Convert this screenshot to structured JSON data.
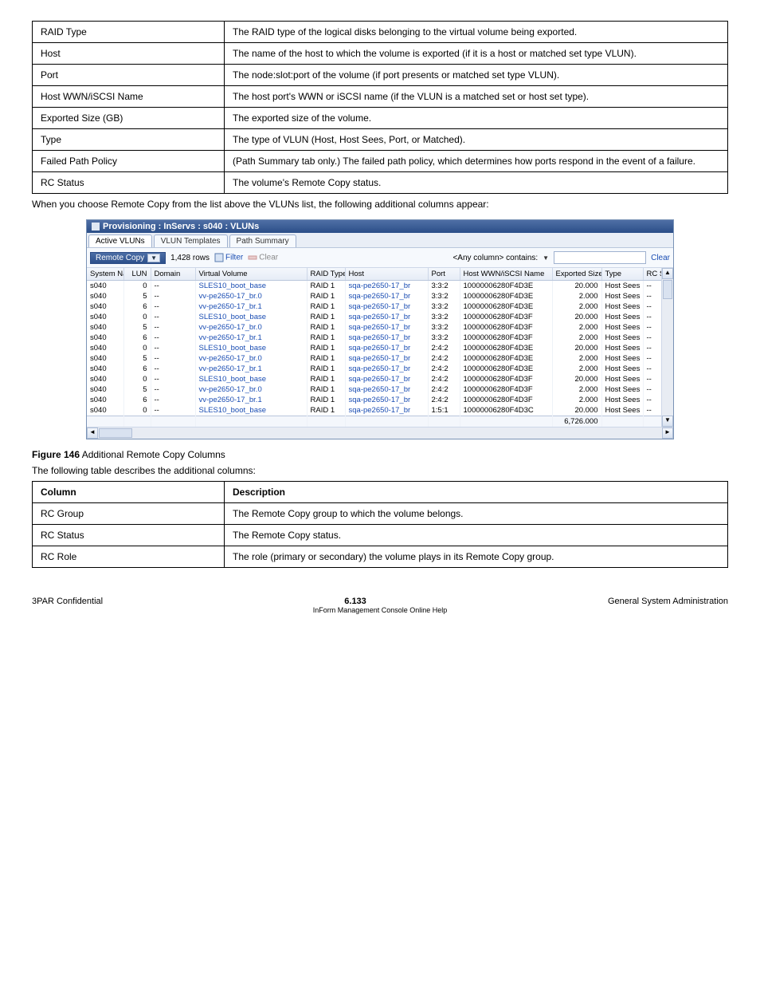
{
  "desc_top": [
    {
      "k": "RAID Type",
      "v": "The RAID type of the logical disks belonging to the virtual volume being exported."
    },
    {
      "k": "Host",
      "v": "The name of the host to which the volume is exported (if it is a host or matched set type VLUN)."
    },
    {
      "k": "Port",
      "v": "The node:slot:port of the volume (if port presents or matched set type VLUN)."
    },
    {
      "k": "Host WWN/iSCSI Name",
      "v": "The host port's WWN or iSCSI name (if the VLUN is a matched set or host set type)."
    },
    {
      "k": "Exported Size (GB)",
      "v": "The exported size of the volume."
    },
    {
      "k": "Type",
      "v": "The type of VLUN (Host, Host Sees, Port, or Matched)."
    },
    {
      "k": "Failed Path Policy",
      "v": "(Path Summary tab only.) The failed path policy, which determines how ports respond in the event of a failure."
    },
    {
      "k": "RC Status",
      "v": "The volume's Remote Copy status."
    }
  ],
  "intro_remote": "When you choose Remote Copy from the list above the VLUNs list, the following additional columns appear:",
  "figure_caption": {
    "num": "Figure 146",
    "text": " Additional Remote Copy Columns"
  },
  "desc_rc_intro": "The following table describes the additional columns:",
  "desc_rc": [
    {
      "k": "Column",
      "v": "Description"
    },
    {
      "k": "RC Group",
      "v": "The Remote Copy group to which the volume belongs."
    },
    {
      "k": "RC Status",
      "v": "The Remote Copy status."
    },
    {
      "k": "RC Role",
      "v": "The role (primary or secondary) the volume plays in its Remote Copy group."
    }
  ],
  "footer": {
    "left": "3PAR Confidential",
    "right": "General System Administration",
    "page": "6.133",
    "sub": "InForm Management Console Online Help "
  },
  "shot": {
    "title": "Provisioning : InServs : s040 : VLUNs",
    "tabs": [
      "Active VLUNs",
      "VLUN Templates",
      "Path Summary"
    ],
    "active_tab": 0,
    "combo_label": "Remote Copy",
    "rows_label": "1,428 rows",
    "filter_label": "Filter",
    "clear_label_tb": "Clear",
    "search_label": "<Any column> contains:",
    "clear_link": "Clear",
    "headers": [
      "System Name",
      "LUN",
      "Domain",
      "Virtual Volume",
      "RAID Type",
      "Host",
      "Port",
      "Host WWN/iSCSI Name",
      "Exported Size (GB)",
      "Type",
      "RC Status"
    ],
    "rows": [
      {
        "sys": "s040",
        "lun": "0",
        "dom": "--",
        "vv": "SLES10_boot_base",
        "raid": "RAID 1",
        "host": "sqa-pe2650-17_br",
        "port": "3:3:2",
        "wwn": "10000006280F4D3E",
        "size": "20.000",
        "type": "Host Sees",
        "rc": "--"
      },
      {
        "sys": "s040",
        "lun": "5",
        "dom": "--",
        "vv": "vv-pe2650-17_br.0",
        "raid": "RAID 1",
        "host": "sqa-pe2650-17_br",
        "port": "3:3:2",
        "wwn": "10000006280F4D3E",
        "size": "2.000",
        "type": "Host Sees",
        "rc": "--"
      },
      {
        "sys": "s040",
        "lun": "6",
        "dom": "--",
        "vv": "vv-pe2650-17_br.1",
        "raid": "RAID 1",
        "host": "sqa-pe2650-17_br",
        "port": "3:3:2",
        "wwn": "10000006280F4D3E",
        "size": "2.000",
        "type": "Host Sees",
        "rc": "--"
      },
      {
        "sys": "s040",
        "lun": "0",
        "dom": "--",
        "vv": "SLES10_boot_base",
        "raid": "RAID 1",
        "host": "sqa-pe2650-17_br",
        "port": "3:3:2",
        "wwn": "10000006280F4D3F",
        "size": "20.000",
        "type": "Host Sees",
        "rc": "--"
      },
      {
        "sys": "s040",
        "lun": "5",
        "dom": "--",
        "vv": "vv-pe2650-17_br.0",
        "raid": "RAID 1",
        "host": "sqa-pe2650-17_br",
        "port": "3:3:2",
        "wwn": "10000006280F4D3F",
        "size": "2.000",
        "type": "Host Sees",
        "rc": "--"
      },
      {
        "sys": "s040",
        "lun": "6",
        "dom": "--",
        "vv": "vv-pe2650-17_br.1",
        "raid": "RAID 1",
        "host": "sqa-pe2650-17_br",
        "port": "3:3:2",
        "wwn": "10000006280F4D3F",
        "size": "2.000",
        "type": "Host Sees",
        "rc": "--"
      },
      {
        "sys": "s040",
        "lun": "0",
        "dom": "--",
        "vv": "SLES10_boot_base",
        "raid": "RAID 1",
        "host": "sqa-pe2650-17_br",
        "port": "2:4:2",
        "wwn": "10000006280F4D3E",
        "size": "20.000",
        "type": "Host Sees",
        "rc": "--"
      },
      {
        "sys": "s040",
        "lun": "5",
        "dom": "--",
        "vv": "vv-pe2650-17_br.0",
        "raid": "RAID 1",
        "host": "sqa-pe2650-17_br",
        "port": "2:4:2",
        "wwn": "10000006280F4D3E",
        "size": "2.000",
        "type": "Host Sees",
        "rc": "--"
      },
      {
        "sys": "s040",
        "lun": "6",
        "dom": "--",
        "vv": "vv-pe2650-17_br.1",
        "raid": "RAID 1",
        "host": "sqa-pe2650-17_br",
        "port": "2:4:2",
        "wwn": "10000006280F4D3E",
        "size": "2.000",
        "type": "Host Sees",
        "rc": "--"
      },
      {
        "sys": "s040",
        "lun": "0",
        "dom": "--",
        "vv": "SLES10_boot_base",
        "raid": "RAID 1",
        "host": "sqa-pe2650-17_br",
        "port": "2:4:2",
        "wwn": "10000006280F4D3F",
        "size": "20.000",
        "type": "Host Sees",
        "rc": "--"
      },
      {
        "sys": "s040",
        "lun": "5",
        "dom": "--",
        "vv": "vv-pe2650-17_br.0",
        "raid": "RAID 1",
        "host": "sqa-pe2650-17_br",
        "port": "2:4:2",
        "wwn": "10000006280F4D3F",
        "size": "2.000",
        "type": "Host Sees",
        "rc": "--"
      },
      {
        "sys": "s040",
        "lun": "6",
        "dom": "--",
        "vv": "vv-pe2650-17_br.1",
        "raid": "RAID 1",
        "host": "sqa-pe2650-17_br",
        "port": "2:4:2",
        "wwn": "10000006280F4D3F",
        "size": "2.000",
        "type": "Host Sees",
        "rc": "--"
      },
      {
        "sys": "s040",
        "lun": "0",
        "dom": "--",
        "vv": "SLES10_boot_base",
        "raid": "RAID 1",
        "host": "sqa-pe2650-17_br",
        "port": "1:5:1",
        "wwn": "10000006280F4D3C",
        "size": "20.000",
        "type": "Host Sees",
        "rc": "--"
      }
    ],
    "sum_size": "6,726.000"
  }
}
